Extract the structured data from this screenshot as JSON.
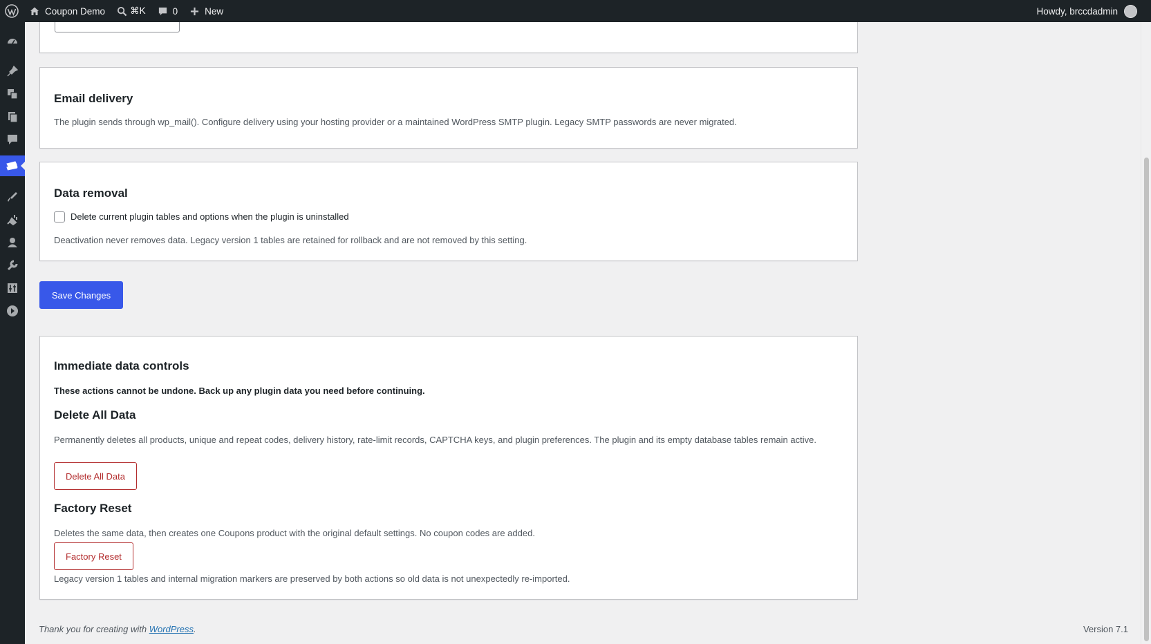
{
  "adminbar": {
    "site_name": "Coupon Demo",
    "search_shortcut": "⌘K",
    "comments_count": "0",
    "new_label": "New",
    "greeting": "Howdy, brccdadmin"
  },
  "sidemenu": {
    "icons": [
      "dashboard-icon",
      "posts-icon",
      "media-icon",
      "pages-icon",
      "comments-icon",
      "coupons-plugin-icon",
      "appearance-icon",
      "plugins-icon",
      "users-icon",
      "tools-icon",
      "settings-icon",
      "collapse-menu-icon"
    ],
    "current": "coupons-plugin-icon",
    "accent_color": "#3858e9"
  },
  "email_delivery": {
    "title": "Email delivery",
    "description": "The plugin sends through wp_mail(). Configure delivery using your hosting provider or a maintained WordPress SMTP plugin. Legacy SMTP passwords are never migrated."
  },
  "data_removal": {
    "title": "Data removal",
    "checkbox_label": "Delete current plugin tables and options when the plugin is uninstalled",
    "checkbox_checked": false,
    "note": "Deactivation never removes data. Legacy version 1 tables are retained for rollback and are not removed by this setting."
  },
  "save_button": "Save Changes",
  "immediate": {
    "title": "Immediate data controls",
    "warning": "These actions cannot be undone. Back up any plugin data you need before continuing.",
    "delete_all": {
      "heading": "Delete All Data",
      "description": "Permanently deletes all products, unique and repeat codes, delivery history, rate-limit records, CAPTCHA keys, and plugin preferences. The plugin and its empty database tables remain active.",
      "button": "Delete All Data"
    },
    "factory_reset": {
      "heading": "Factory Reset",
      "description": "Deletes the same data, then creates one Coupons product with the original default settings. No coupon codes are added.",
      "button": "Factory Reset"
    },
    "footnote": "Legacy version 1 tables and internal migration markers are preserved by both actions so old data is not unexpectedly re-imported."
  },
  "footer": {
    "thanks_prefix": "Thank you for creating with ",
    "link": "WordPress",
    "suffix": ".",
    "version": "Version 7.1"
  }
}
